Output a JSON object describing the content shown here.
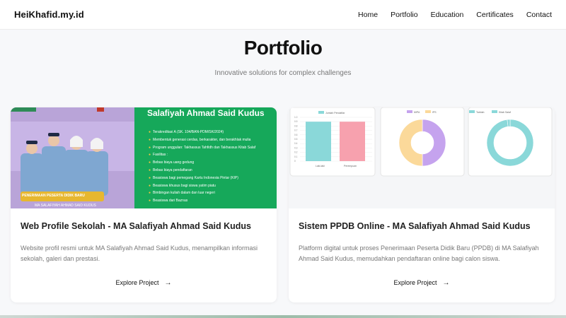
{
  "brand": "HeiKhafid.my.id",
  "nav": [
    "Home",
    "Portfolio",
    "Education",
    "Certificates",
    "Contact"
  ],
  "hero": {
    "title": "Portfolio",
    "subtitle": "Innovative solutions for complex challenges"
  },
  "cards": [
    {
      "title": "Web Profile Sekolah - MA Salafiyah Ahmad Said Kudus",
      "description": "Website profil resmi untuk MA Salafiyah Ahmad Said Kudus, menampilkan informasi sekolah, galeri dan prestasi.",
      "cta": "Explore Project",
      "image": {
        "heading": "Salafiyah Ahmad Said Kudus",
        "lines": [
          "Terakreditasi A (SK. 104/BAN-PDM/SK/2024)",
          "Membentuk generasi cerdas, berkarakter, dan berakhlak mulia",
          "Program unggulan: Takhassus Tahfidh dan Takhassus Kitab Salaf",
          "Fasilitas :",
          "Bebas biaya uang gedung",
          "Bebas biaya pendaftaran",
          "Beasiswa bagi pemegang Kartu Indonesia Pintar (KIP)",
          "Beasiswa khusus bagi siswa yatim piatu",
          "Bimbingan kuliah dalam dan luar negeri",
          "Beasiswa dari Baznas"
        ],
        "banner": "PENERIMAAN PESERTA DIDIK BARU",
        "banner_sub": "MA SALAFIYAH AHMAD SAID KUDUS"
      }
    },
    {
      "title": "Sistem PPDB Online - MA Salafiyah Ahmad Said Kudus",
      "description": "Platform digital untuk proses Penerimaan Peserta Didik Baru (PPDB) di MA Salafiyah Ahmad Said Kudus, memudahkan pendaftaran online bagi calon siswa.",
      "cta": "Explore Project",
      "image": {
        "bar_legend": "Jumlah Pendaftar",
        "bar_categories": [
          "Laki-laki",
          "Perempuan"
        ],
        "bar_values": [
          0.9,
          0.9
        ],
        "bar_ticks": [
          "1.0",
          "0.9",
          "0.8",
          "0.7",
          "0.6",
          "0.5",
          "0.4",
          "0.3",
          "0.2",
          "0.1",
          "0"
        ],
        "donut1_legend": [
          "MIPA",
          "IPS"
        ],
        "donut1_values": [
          50,
          50
        ],
        "donut2_legend": [
          "Tarbiah",
          "Kitab Salaf"
        ],
        "donut2_values": [
          98,
          2
        ],
        "colors": {
          "teal": "#8ad8d9",
          "pink": "#f7a1ae",
          "purple": "#c5a3ee",
          "yellow": "#fbd99a"
        }
      }
    }
  ]
}
